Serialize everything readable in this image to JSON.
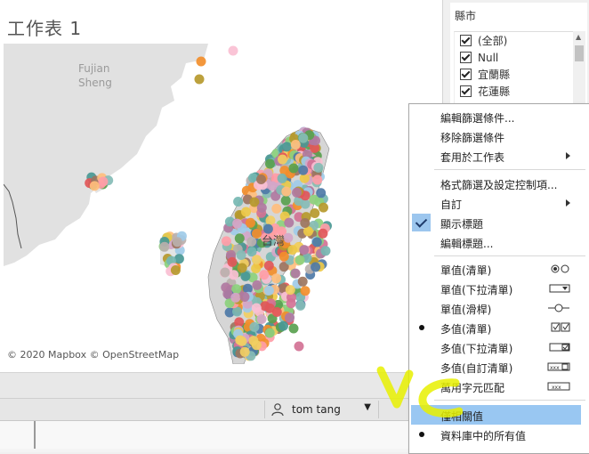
{
  "sheet": {
    "title": "工作表 1",
    "map_attribution": "© 2020 Mapbox © OpenStreetMap",
    "map_labels": [
      "Fujian",
      "Sheng"
    ],
    "map_center_label": "台灣"
  },
  "filter": {
    "title": "縣市",
    "items": [
      {
        "label": "(全部)",
        "checked": true
      },
      {
        "label": "Null",
        "checked": true
      },
      {
        "label": "宜蘭縣",
        "checked": true
      },
      {
        "label": "花蓮縣",
        "checked": true
      }
    ]
  },
  "status": {
    "user_name": "tom tang"
  },
  "context_menu": {
    "items": [
      {
        "label": "編輯篩選條件..."
      },
      {
        "label": "移除篩選條件"
      },
      {
        "label": "套用於工作表",
        "submenu": true
      },
      {
        "label": "格式篩選及設定控制項..."
      },
      {
        "label": "自訂",
        "submenu": true
      },
      {
        "label": "顯示標題",
        "checked": true
      },
      {
        "label": "編輯標題..."
      },
      {
        "label": "單值(清單)",
        "glyph": "radio-list-icon"
      },
      {
        "label": "單值(下拉清單)",
        "glyph": "dropdown-icon"
      },
      {
        "label": "單值(滑桿)",
        "glyph": "slider-icon"
      },
      {
        "label": "多值(清單)",
        "glyph": "checkbox-list-icon",
        "selected": true
      },
      {
        "label": "多值(下拉清單)",
        "glyph": "dropdown-check-icon"
      },
      {
        "label": "多值(自訂清單)",
        "glyph": "custom-list-icon"
      },
      {
        "label": "萬用字元匹配",
        "glyph": "wildcard-icon"
      },
      {
        "label": "僅相關值",
        "highlighted": true
      },
      {
        "label": "資料庫中的所有值",
        "selected": true
      }
    ]
  },
  "colors": {
    "menu_highlight": "#99c7f2",
    "annotation": "#f2f200",
    "land_china": "#e1e1e1",
    "land_taiwan": "#d6d6d6"
  }
}
